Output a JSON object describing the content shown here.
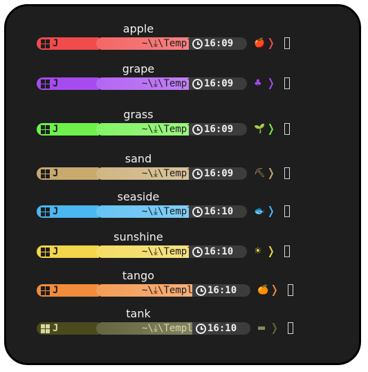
{
  "themes": [
    {
      "title": "apple",
      "user": "J",
      "path": "~\\⤓\\Templates",
      "time": "16:09",
      "icon": "🍎",
      "icon_name": "apple-icon",
      "chevron": "❭",
      "accent": "#f24b4b",
      "fg": "#1e1e1e"
    },
    {
      "title": "grape",
      "user": "J",
      "path": "~\\⤓\\Templates",
      "time": "16:09",
      "icon": "♣",
      "icon_name": "grape-icon",
      "chevron": "❭",
      "accent": "#a64bf0",
      "fg": "#1e1e1e"
    },
    {
      "title": "grass",
      "user": "J",
      "path": "~\\⤓\\Templates",
      "time": "16:09",
      "icon": "🌱",
      "icon_name": "sprout-icon",
      "chevron": "❭",
      "accent": "#6ef24b",
      "fg": "#1e1e1e"
    },
    {
      "title": "sand",
      "user": "J",
      "path": "~\\⤓\\Templates",
      "time": "16:09",
      "icon": "⛏",
      "icon_name": "shovel-icon",
      "chevron": "❭",
      "accent": "#c8a96e",
      "fg": "#1e1e1e"
    },
    {
      "title": "seaside",
      "user": "J",
      "path": "~\\⤓\\Templates",
      "time": "16:10",
      "icon": "🐟",
      "icon_name": "fish-icon",
      "chevron": "❭",
      "accent": "#4bb8f2",
      "fg": "#1e1e1e"
    },
    {
      "title": "sunshine",
      "user": "J",
      "path": "~\\⤓\\Templates",
      "time": "16:10",
      "icon": "☀",
      "icon_name": "sun-icon",
      "chevron": "❭",
      "accent": "#f2d64b",
      "fg": "#1e1e1e"
    },
    {
      "title": "tango",
      "user": "J",
      "path": "~\\⤓\\Templates",
      "time": "16:10",
      "icon": "🍊",
      "icon_name": "orange-icon",
      "chevron": "❭",
      "accent": "#f28c3c",
      "fg": "#1e1e1e"
    },
    {
      "title": "tank",
      "user": "J",
      "path": "~\\⤓\\Templates",
      "time": "16:10",
      "icon": "▬",
      "icon_name": "tank-icon",
      "chevron": "❭",
      "accent": "#4a4a1e",
      "fg": "#d8d8a0"
    }
  ]
}
